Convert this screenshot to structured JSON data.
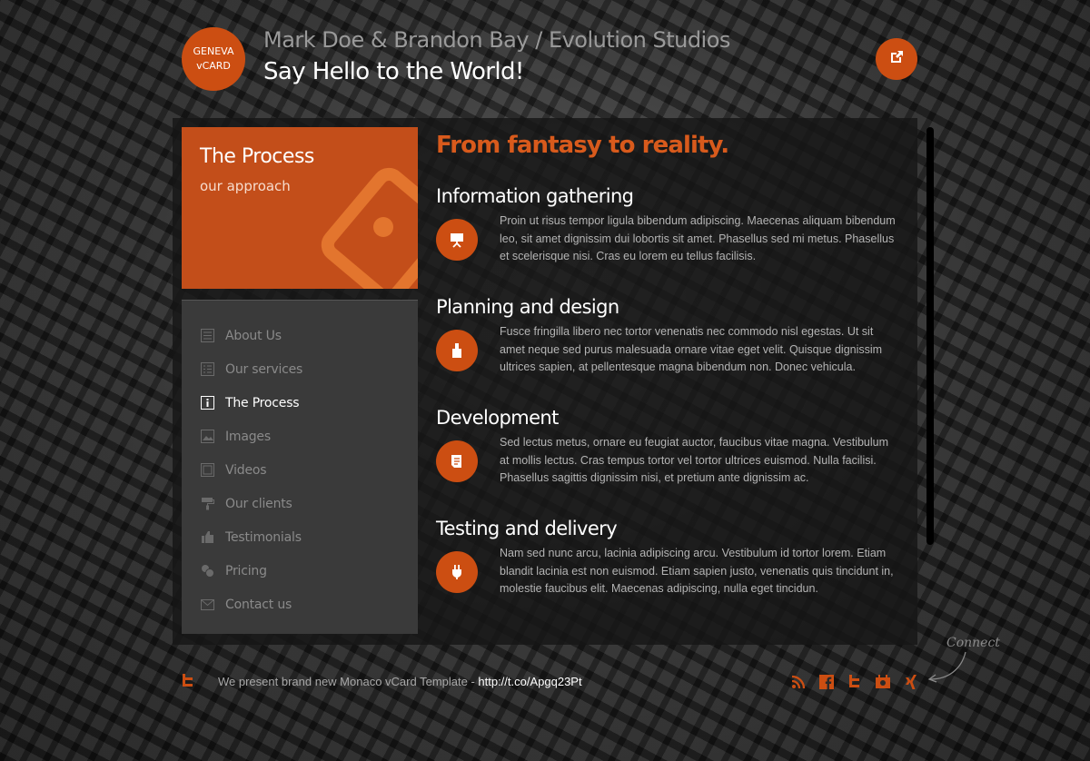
{
  "brand": {
    "logo_line1": "GENEVA",
    "logo_line2": "vCARD"
  },
  "header": {
    "title": "Mark Doe & Brandon Bay / Evolution Studios",
    "tagline": "Say Hello to the World!",
    "external_icon": "external-link-icon"
  },
  "hero": {
    "title": "The Process",
    "subtitle": "our approach"
  },
  "nav": {
    "items": [
      {
        "label": "About Us",
        "icon": "list-icon"
      },
      {
        "label": "Our services",
        "icon": "list-icon"
      },
      {
        "label": "The Process",
        "icon": "info-icon",
        "active": true
      },
      {
        "label": "Images",
        "icon": "image-icon"
      },
      {
        "label": "Videos",
        "icon": "video-icon"
      },
      {
        "label": "Our clients",
        "icon": "paint-roller-icon"
      },
      {
        "label": "Testimonials",
        "icon": "thumbs-up-icon"
      },
      {
        "label": "Pricing",
        "icon": "coins-icon"
      },
      {
        "label": "Contact us",
        "icon": "envelope-icon"
      }
    ]
  },
  "content": {
    "title": "From fantasy to reality.",
    "steps": [
      {
        "title": "Information gathering",
        "icon": "presentation-icon",
        "text": "Proin ut risus tempor ligula bibendum adipiscing. Maecenas aliquam bibendum leo, sit amet dignissim dui lobortis sit amet. Phasellus sed mi metus. Phasellus et scelerisque nisi. Cras eu lorem eu tellus facilisis."
      },
      {
        "title": "Planning and design",
        "icon": "brush-icon",
        "text": "Fusce fringilla libero nec tortor venenatis nec commodo nisl egestas. Ut sit amet neque sed purus malesuada ornare vitae eget velit. Quisque dignissim ultrices sapien, at pellentesque magna bibendum non. Donec vehicula."
      },
      {
        "title": "Development",
        "icon": "document-icon",
        "text": "Sed lectus metus, ornare eu feugiat auctor, faucibus vitae magna. Vestibulum at mollis lectus. Cras tempus tortor vel tortor ultrices euismod. Nulla facilisi. Phasellus sagittis dignissim nisi, et pretium ante dignissim ac."
      },
      {
        "title": "Testing and delivery",
        "icon": "plug-icon",
        "text": "Nam sed nunc arcu, lacinia adipiscing arcu. Vestibulum id tortor lorem. Etiam blandit lacinia est non euismod. Etiam sapien justo, venenatis quis tincidunt in, molestie faucibus elit. Maecenas adipiscing, nulla eget tincidun."
      }
    ]
  },
  "footer": {
    "tweet_text": "We present brand new Monaco vCard Template - ",
    "tweet_link": "http://t.co/Apgq23Pt",
    "connect_label": "Connect",
    "social": [
      "rss-icon",
      "facebook-icon",
      "twitter-icon",
      "youtube-icon",
      "xing-icon"
    ]
  },
  "colors": {
    "accent": "#cc4e12",
    "panel": "#161616",
    "nav_bg": "#3a3a3a",
    "text_muted": "#8a8a8a"
  }
}
